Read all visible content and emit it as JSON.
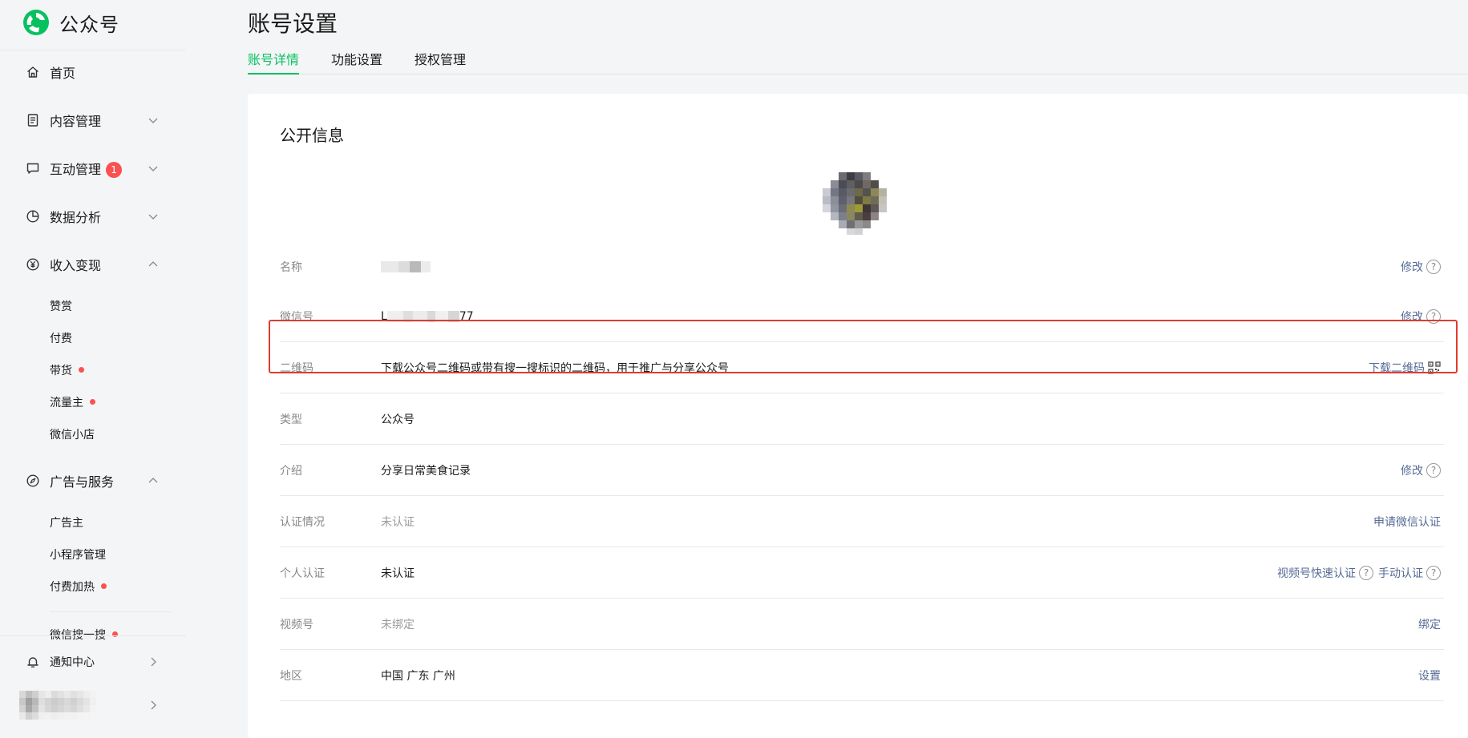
{
  "brand": {
    "name": "公众号"
  },
  "colors": {
    "accent": "#07c160",
    "link": "#576b95",
    "badge": "#fa5151",
    "highlight": "#e03c31"
  },
  "sidebar": {
    "items": [
      {
        "label": "首页",
        "icon": "home-icon"
      },
      {
        "label": "内容管理",
        "icon": "document-icon"
      },
      {
        "label": "互动管理",
        "icon": "chat-icon",
        "badge": "1"
      },
      {
        "label": "数据分析",
        "icon": "chart-pie-icon"
      },
      {
        "label": "收入变现",
        "icon": "yuan-icon"
      },
      {
        "label": "广告与服务",
        "icon": "compass-icon"
      }
    ],
    "income_sub": [
      "赞赏",
      "付费",
      "带货",
      "流量主",
      "微信小店"
    ],
    "ads_sub": [
      "广告主",
      "小程序管理",
      "付费加热"
    ],
    "cut_item": "微信搜一搜",
    "notification": "通知中心"
  },
  "page": {
    "title": "账号设置"
  },
  "tabs": [
    "账号详情",
    "功能设置",
    "授权管理"
  ],
  "card": {
    "section_title": "公开信息",
    "rows": [
      {
        "label": "名称",
        "value": "",
        "action": "修改"
      },
      {
        "label": "微信号",
        "value_prefix": "L",
        "value_suffix": "77",
        "action": "修改"
      },
      {
        "label": "二维码",
        "value": "下载公众号二维码或带有搜一搜标识的二维码，用于推广与分享公众号",
        "action": "下载二维码"
      },
      {
        "label": "类型",
        "value": "公众号"
      },
      {
        "label": "介绍",
        "value": "分享日常美食记录",
        "action": "修改"
      },
      {
        "label": "认证情况",
        "value": "未认证",
        "action": "申请微信认证"
      },
      {
        "label": "个人认证",
        "value": "未认证",
        "action": "视频号快速认证",
        "action2": "手动认证"
      },
      {
        "label": "视频号",
        "value": "未绑定",
        "action": "绑定"
      },
      {
        "label": "地区",
        "value": "中国 广东 广州",
        "action": "设置"
      }
    ]
  }
}
